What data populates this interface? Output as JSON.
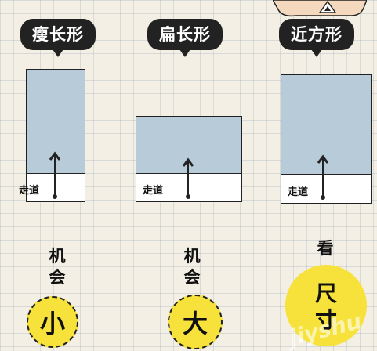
{
  "columns": [
    {
      "title": "瘦长形",
      "aisle_label": "走道",
      "chance_label": [
        "机",
        "会"
      ],
      "circle_text": "小"
    },
    {
      "title": "扁长形",
      "aisle_label": "走道",
      "chance_label": [
        "机",
        "会"
      ],
      "circle_text": "大"
    },
    {
      "title": "近方形",
      "aisle_label": "走道",
      "chance_label": [
        "看"
      ],
      "circle_text": [
        "尺",
        "寸"
      ]
    }
  ],
  "watermark": "jiyshu",
  "colors": {
    "room_fill": "#b7cbd9",
    "circle": "#f6e23a",
    "bubble": "#222222"
  }
}
